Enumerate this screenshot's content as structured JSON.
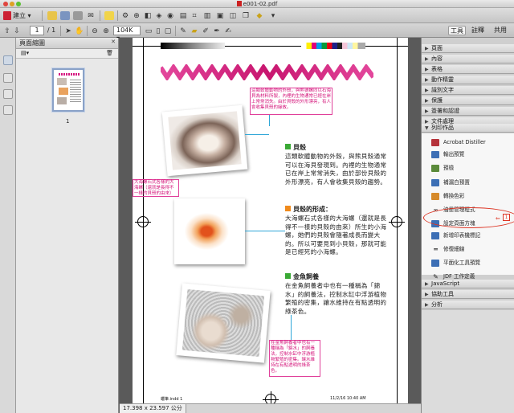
{
  "window": {
    "title": "e001-02.pdf"
  },
  "toolbar": {
    "create_label": "建立",
    "page_current": "1",
    "page_total": "/ 1",
    "zoom_value": "104K",
    "tab_tools": "工具",
    "tab_comment": "註釋",
    "tab_share": "共用"
  },
  "left_panel": {
    "title": "頁面縮圖",
    "thumb_number": "1"
  },
  "document": {
    "annotations": [
      "這類軟體動物的外殼，與熊德螺同以石海貝為材料所製，內裡的生物通常已經在岸上常常消失。由於貝殼的外形漂亮，有人會收集貝殼的緣故。",
      "大海螺石式各樣的大海螺（還就是長得不一樣的貝殼的由來）",
      "在金魚飼養者中也有一種稱為「錦水」的飼養法，控制水缸中浮游植物繁殖的密集。讓水維持在有點透明的綠茶色。"
    ],
    "sections": [
      {
        "heading": "貝殼",
        "color": "#3aa935",
        "body": "這類軟體動物的外殼，與熊貝殼通常可以在海貝發現到。內裡的生物通常已在岸上常常消失，由於部份貝殼的外形漂亮，有人會收集貝殼的趨勢。"
      },
      {
        "heading": "貝殼的形成：",
        "color": "#f08a1c",
        "body": "大海螺石式各樣的大海螺（還就是長得不一樣的貝殼的由來）所生的小海螺，她們的貝殼會隨著成長而變大的。所以可要見到小貝殼，那就可能是已經死的小海螺。"
      },
      {
        "heading": "金魚飼養",
        "color": "#3aa935",
        "body": "在金魚飼養者中也有一種稱為「錦水」的飼養法，控制水缸中浮游植物繁殖的密集，讓水維持在有點透明的綠茶色。"
      }
    ],
    "footer_left": "蠟筆.indd   1",
    "footer_right": "11/2/16   10:40 AM"
  },
  "status": {
    "dimensions": "17.398 x 23.597 公分"
  },
  "right_panel": {
    "sections_top": [
      "頁面",
      "內容",
      "表格",
      "動作精靈",
      "識別文字",
      "保護",
      "簽署和認證",
      "文件處理"
    ],
    "print_section": "列印作品",
    "tools": [
      {
        "label": "Acrobat Distiller",
        "icon": "distiller-icon",
        "color": "#b5323a"
      },
      {
        "label": "輸出預覽",
        "icon": "output-preview-icon",
        "color": "#3c6fb5"
      },
      {
        "label": "預檢",
        "icon": "preflight-icon",
        "color": "#5a8a3a"
      },
      {
        "label": "補漏白預置",
        "icon": "trap-presets-icon",
        "color": "#3c6fb5"
      },
      {
        "label": "轉換色彩",
        "icon": "convert-colors-icon",
        "color": "#d68a2a"
      },
      {
        "label": "油墨管理程式",
        "icon": "ink-manager-icon",
        "color": "#777777"
      },
      {
        "label": "設定頁面方塊",
        "icon": "set-page-boxes-icon",
        "color": "#3c6fb5"
      },
      {
        "label": "新增印表機標記",
        "icon": "printer-marks-icon",
        "color": "#3c6fb5"
      },
      {
        "label": "修復細線",
        "icon": "fix-hairlines-icon",
        "color": "#777777"
      },
      {
        "label": "平面化工具預覽",
        "icon": "flattener-icon",
        "color": "#3c6fb5"
      },
      {
        "label": "JDF 工作定義",
        "icon": "jdf-icon",
        "color": "#777777"
      }
    ],
    "sections_bottom": [
      "JavaScript",
      "協助工具",
      "分析"
    ],
    "callout_number": "1"
  }
}
